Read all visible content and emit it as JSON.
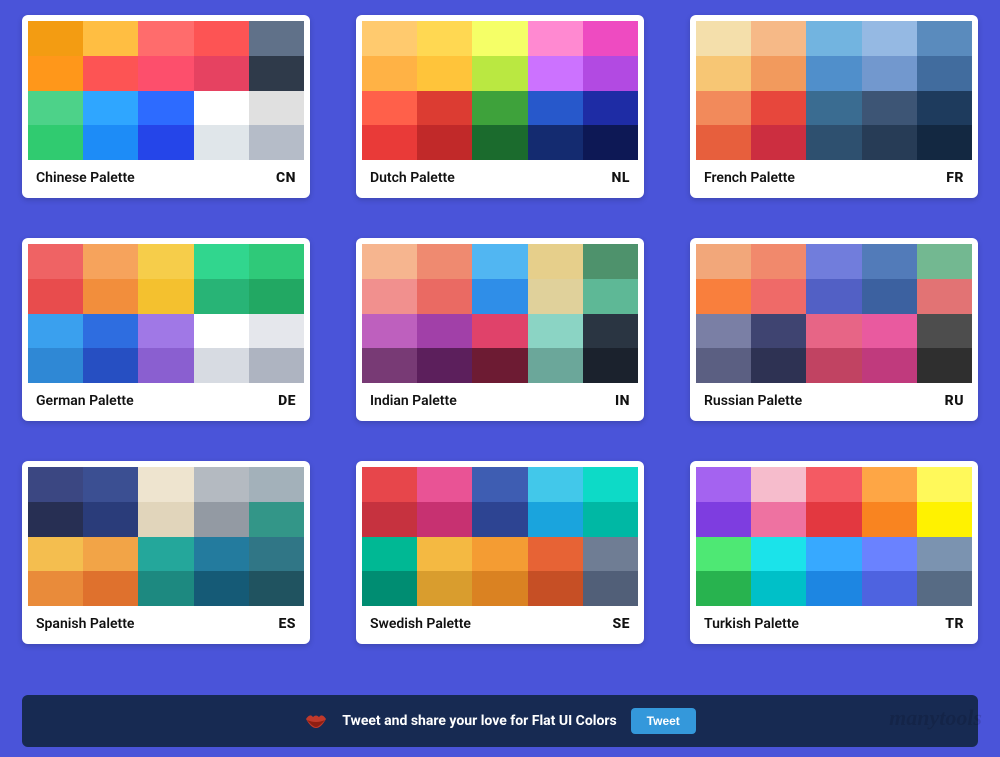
{
  "palettes": [
    {
      "name": "Chinese Palette",
      "code": "CN",
      "colors": [
        "#f39c12",
        "#ffbe42",
        "#ff6c6c",
        "#fd5454",
        "#607189",
        "#ff971a",
        "#fd5454",
        "#fd4f6c",
        "#e64261",
        "#2f3a4a",
        "#4dd289",
        "#2fa6ff",
        "#2d6bff",
        "#ffffff",
        "#e0e0e0",
        "#30cb70",
        "#1d8cf7",
        "#2545e9",
        "#e0e6ea",
        "#b5bcc8"
      ]
    },
    {
      "name": "Dutch Palette",
      "code": "NL",
      "colors": [
        "#ffca6e",
        "#ffd852",
        "#f5ff67",
        "#ff89d1",
        "#ee4bc1",
        "#ffb245",
        "#ffc43a",
        "#bae841",
        "#cc72ff",
        "#b24ae2",
        "#ff604a",
        "#dc3c32",
        "#3ea23b",
        "#2758cb",
        "#1e2ca5",
        "#e93a38",
        "#c12929",
        "#1b6b2d",
        "#142b70",
        "#0d1855"
      ]
    },
    {
      "name": "French Palette",
      "code": "FR",
      "colors": [
        "#f4dfab",
        "#f6b987",
        "#72b4e0",
        "#95b9e3",
        "#5a8bbd",
        "#f7c674",
        "#f29a5d",
        "#508fcb",
        "#7298ce",
        "#416c9e",
        "#f28a5b",
        "#e7473c",
        "#3a6c91",
        "#3d5575",
        "#1e3b5d",
        "#e75f3d",
        "#cc2e40",
        "#2e506f",
        "#273c56",
        "#132841"
      ]
    },
    {
      "name": "German Palette",
      "code": "DE",
      "colors": [
        "#ef6364",
        "#f6a35c",
        "#f6cd4a",
        "#31d68e",
        "#2fc979",
        "#e84c4d",
        "#f28e3c",
        "#f4c12f",
        "#28b476",
        "#22a863",
        "#3aa0ee",
        "#2e6de0",
        "#a078e6",
        "#ffffff",
        "#e5e7ec",
        "#2f88d5",
        "#264fc2",
        "#8a5fd0",
        "#d7dbe2",
        "#aeb4c1"
      ]
    },
    {
      "name": "Indian Palette",
      "code": "IN",
      "colors": [
        "#f6b58f",
        "#ef8a70",
        "#51b6f2",
        "#e6cf8b",
        "#4e926c",
        "#f1908e",
        "#ea6a63",
        "#2f8ee8",
        "#e0d19b",
        "#5eb896",
        "#be60be",
        "#a140a8",
        "#e0426a",
        "#8bd4c4",
        "#2a3542",
        "#783a75",
        "#5c1f5c",
        "#6d1b33",
        "#6ba79a",
        "#1b222d"
      ]
    },
    {
      "name": "Russian Palette",
      "code": "RU",
      "colors": [
        "#f2a77a",
        "#f1896c",
        "#717ddc",
        "#527bb9",
        "#73b891",
        "#f97f3d",
        "#ef6a68",
        "#5260c5",
        "#3c61a0",
        "#e27374",
        "#7a7fa5",
        "#3f4471",
        "#e76586",
        "#e95a9f",
        "#4d4d4d",
        "#5b5f82",
        "#2e3253",
        "#c14362",
        "#c03a7d",
        "#2f2f2f"
      ]
    },
    {
      "name": "Spanish Palette",
      "code": "ES",
      "colors": [
        "#3b4782",
        "#3b4f92",
        "#eee4cf",
        "#b4bac1",
        "#a3b1ba",
        "#272f53",
        "#2a3c7a",
        "#e1d5bb",
        "#939aa3",
        "#339688",
        "#f4be4f",
        "#f2a447",
        "#24a79b",
        "#237b9e",
        "#307686",
        "#e98b3a",
        "#df712d",
        "#1d8980",
        "#155a76",
        "#205360"
      ]
    },
    {
      "name": "Swedish Palette",
      "code": "SE",
      "colors": [
        "#e7464b",
        "#e95395",
        "#3e5db2",
        "#42c8ea",
        "#0ddac7",
        "#c6323f",
        "#c73171",
        "#2d4492",
        "#1aa4dd",
        "#00b8a4",
        "#00b894",
        "#f4b942",
        "#f49c33",
        "#e76335",
        "#6f7d94",
        "#008d72",
        "#d99d2e",
        "#da8222",
        "#c64f25",
        "#515f78"
      ]
    },
    {
      "name": "Turkish Palette",
      "code": "TR",
      "colors": [
        "#a463f0",
        "#f6bccc",
        "#f45a63",
        "#fea645",
        "#fff95a",
        "#7e3de0",
        "#ee72a1",
        "#e33840",
        "#f98420",
        "#fff200",
        "#4ee874",
        "#1be3ea",
        "#37a9ff",
        "#6a82ff",
        "#7b93b0",
        "#28b34f",
        "#00c0c8",
        "#1d86e2",
        "#4e63e0",
        "#576b84"
      ]
    }
  ],
  "banner": {
    "text": "Tweet and share your love for Flat UI Colors",
    "button": "Tweet"
  },
  "watermark": "manytools"
}
